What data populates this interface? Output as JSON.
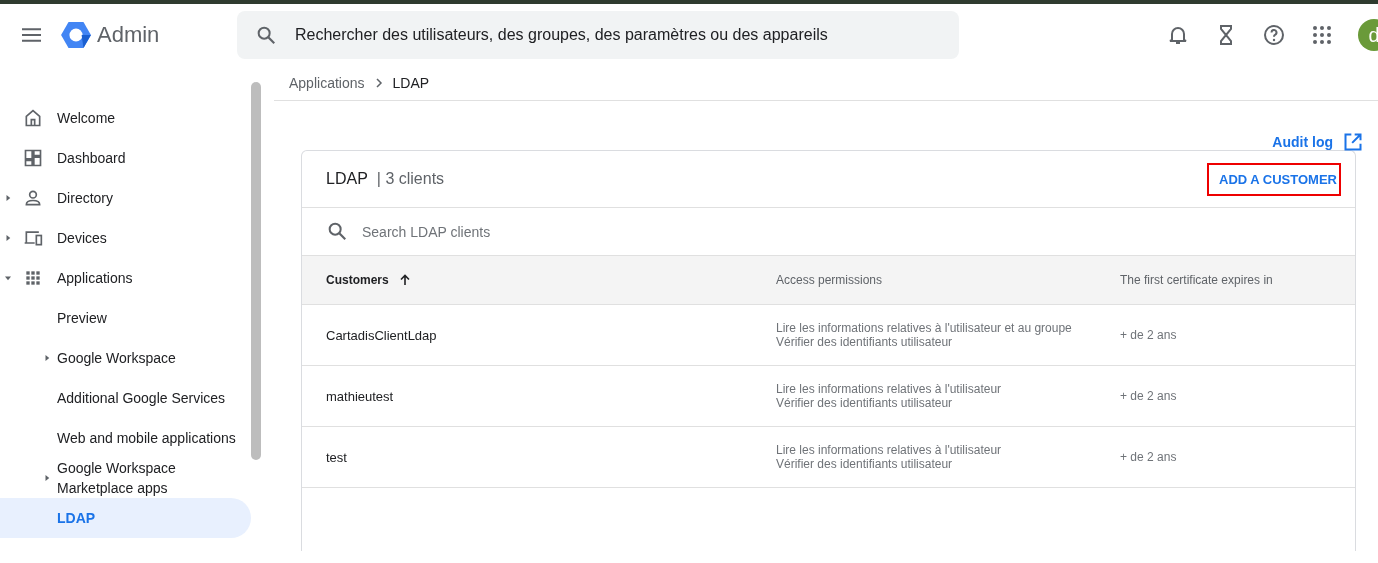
{
  "header": {
    "product": "Admin",
    "search": {
      "placeholder": "Rechercher des utilisateurs, des groupes, des paramètres ou des appareils"
    },
    "avatar": "d"
  },
  "sidebar": {
    "items": [
      {
        "label": "Welcome",
        "selected": false
      },
      {
        "label": "Dashboard",
        "selected": false
      },
      {
        "label": "Directory",
        "expanded": false,
        "selected": false
      },
      {
        "label": "Devices",
        "expanded": false,
        "selected": false
      },
      {
        "label": "Applications",
        "expanded": true,
        "selected": false,
        "children": [
          {
            "label": "Preview",
            "selected": false
          },
          {
            "label": "Google Workspace",
            "expanded": false,
            "selected": false
          },
          {
            "label": "Additional Google Services",
            "selected": false
          },
          {
            "label": "Web and mobile applications",
            "selected": false
          },
          {
            "label": "Google Workspace Marketplace apps",
            "expanded": false,
            "selected": false
          },
          {
            "label": "LDAP",
            "selected": true
          }
        ]
      }
    ]
  },
  "breadcrumb": [
    "Applications",
    "LDAP"
  ],
  "audit_link": "Audit log",
  "card": {
    "title": "LDAP",
    "count": "| 3 clients",
    "add_button": {
      "label": "ADD A CUSTOMER",
      "highlighted": true
    },
    "search": {
      "placeholder": "Search LDAP clients"
    },
    "table": {
      "columns": [
        {
          "label": "Customers",
          "sorted": true
        },
        {
          "label": "Access permissions",
          "sorted": false
        },
        {
          "label": "The first certificate expires in",
          "sorted": false
        }
      ],
      "rows": [
        {
          "name": "CartadisClientLdap",
          "permissions": [
            "Lire les informations relatives à l'utilisateur et au groupe",
            "Vérifier des identifiants utilisateur"
          ],
          "expires": "+ de 2 ans"
        },
        {
          "name": "mathieutest",
          "permissions": [
            "Lire les informations relatives à l'utilisateur",
            "Vérifier des identifiants utilisateur"
          ],
          "expires": "+ de 2 ans"
        },
        {
          "name": "test",
          "permissions": [
            "Lire les informations relatives à l'utilisateur",
            "Vérifier des identifiants utilisateur"
          ],
          "expires": "+ de 2 ans"
        }
      ]
    }
  }
}
